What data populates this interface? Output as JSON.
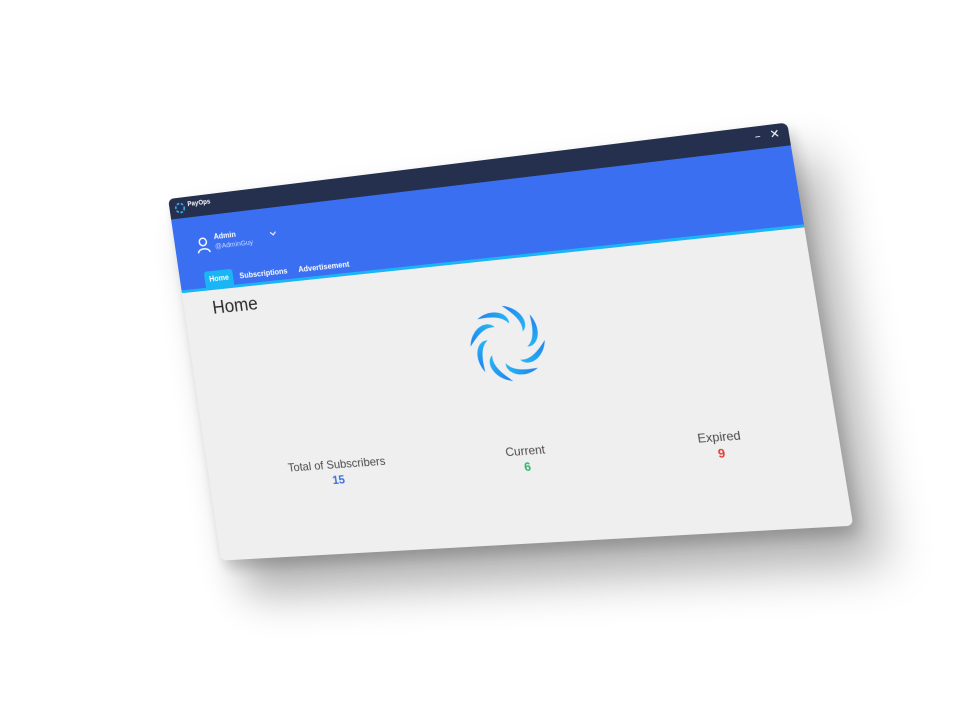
{
  "app": {
    "title": "PayOps",
    "minimize_label": "–",
    "close_label": "✕",
    "logo_icon": "swirl-logo-icon"
  },
  "user": {
    "name": "Admin",
    "handle": "@AdminGuy",
    "avatar_icon": "user-icon",
    "menu_icon": "chevron-down-icon"
  },
  "nav": {
    "tabs": [
      {
        "label": "Home",
        "active": true
      },
      {
        "label": "Subscriptions",
        "active": false
      },
      {
        "label": "Advertisement",
        "active": false
      }
    ]
  },
  "page": {
    "title": "Home"
  },
  "stats": {
    "total": {
      "label": "Total of Subscribers",
      "value": "15",
      "color": "#3b6fe0"
    },
    "current": {
      "label": "Current",
      "value": "6",
      "color": "#2db36c"
    },
    "expired": {
      "label": "Expired",
      "value": "9",
      "color": "#e53935"
    }
  },
  "colors": {
    "titlebar": "#24304d",
    "header": "#3a6ff2",
    "accent": "#19b5f5",
    "background": "#efefef"
  }
}
